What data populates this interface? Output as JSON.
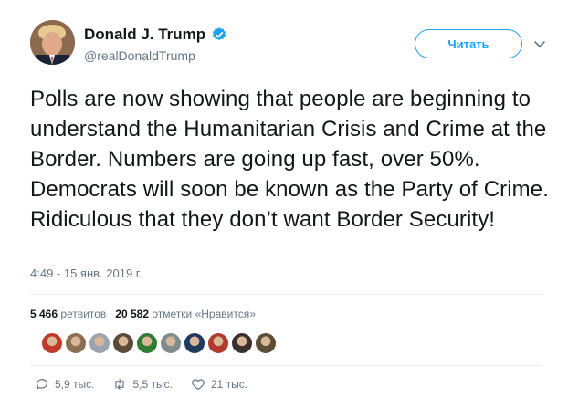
{
  "author": {
    "name": "Donald J. Trump",
    "handle": "@realDonaldTrump",
    "follow_label": "Читать"
  },
  "tweet": {
    "text": "Polls are now showing that people are beginning to understand the Humanitarian Crisis and Crime at the Border. Numbers are going up fast, over 50%. Democrats will soon be known as the Party of Crime. Ridiculous that they don’t want Border Security!",
    "timestamp": "4:49 - 15 янв. 2019 г."
  },
  "stats": {
    "retweets_count": "5 466",
    "retweets_label": "ретвитов",
    "likes_count": "20 582",
    "likes_label": "отметки «Нравится»"
  },
  "likers": [
    "#c0392b",
    "#8e6e53",
    "#9aa5b1",
    "#5a4a3a",
    "#2e7d32",
    "#7f8c8d",
    "#1e3a5f",
    "#b03a2e",
    "#3b2f2f",
    "#5d4e37"
  ],
  "actions": {
    "replies": "5,9 тыс.",
    "retweets": "5,5 тыс.",
    "likes": "21 тыс."
  },
  "colors": {
    "accent": "#1da1f2",
    "secondary_text": "#657786"
  }
}
